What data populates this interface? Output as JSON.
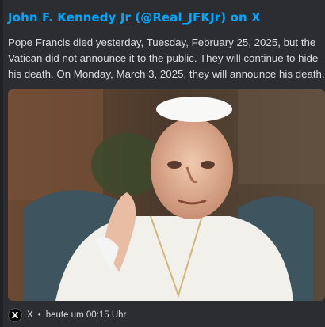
{
  "embed": {
    "author": "John F. Kennedy Jr (@Real_JFKJr) on X",
    "description": "Pope Francis died yesterday, Tuesday, February 25, 2025, but the Vatican did not announce it to the public. They will continue to hide his death. On Monday, March 3, 2025, they will announce his death.",
    "footer": {
      "icon": "x-logo-icon",
      "icon_glyph": "X",
      "provider": "X",
      "separator": "•",
      "timestamp": "heute um 00:15 Uhr"
    }
  }
}
